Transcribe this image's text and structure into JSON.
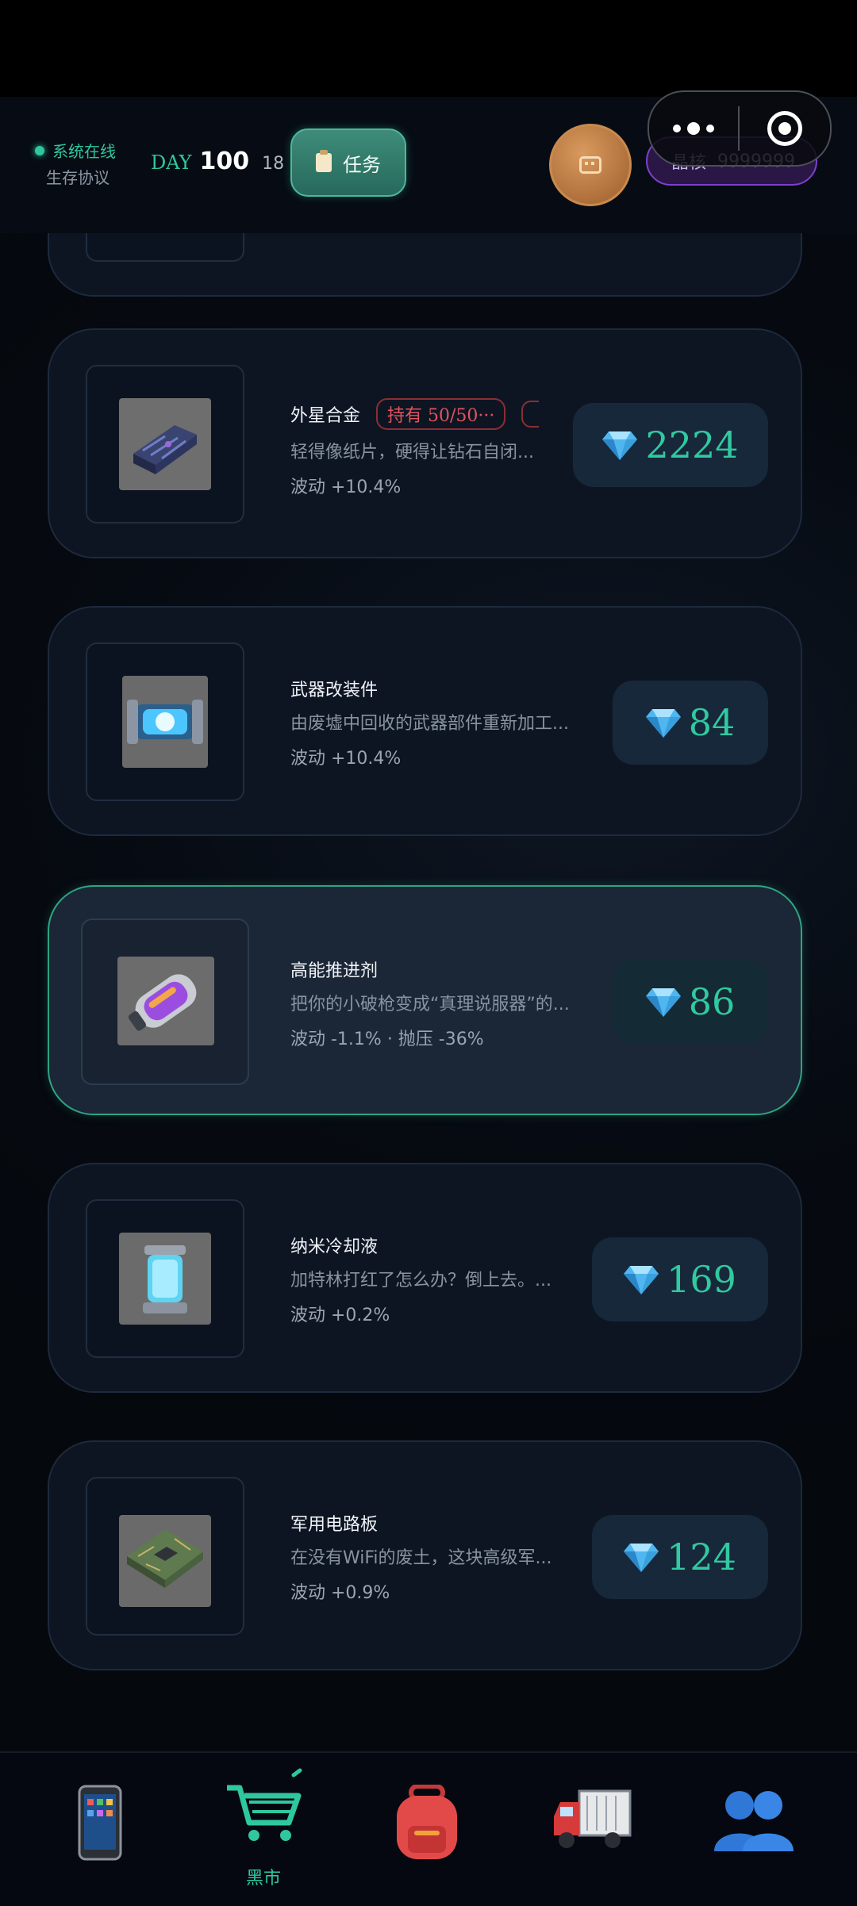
{
  "header": {
    "status_online": "系统在线",
    "status_protocol": "生存协议",
    "day_label": "DAY",
    "day_number": "100",
    "day_sub": "18",
    "task_button": "任务",
    "crystal_label": "晶核",
    "crystal_value": "9999999"
  },
  "items": [
    {
      "name": "外星合金",
      "tag": "持有 50/50···",
      "desc": "轻得像纸片，硬得让钻石自闭...",
      "fluct": "波动 +10.4%",
      "price": "2224"
    },
    {
      "name": "武器改装件",
      "desc": "由废墟中回收的武器部件重新加工...",
      "fluct": "波动 +10.4%",
      "price": "84"
    },
    {
      "name": "高能推进剂",
      "desc": "把你的小破枪变成“真理说服器”的...",
      "fluct": "波动 -1.1% · 抛压 -36%",
      "price": "86"
    },
    {
      "name": "纳米冷却液",
      "desc": "加特林打红了怎么办？倒上去。...",
      "fluct": "波动 +0.2%",
      "price": "169"
    },
    {
      "name": "军用电路板",
      "desc": "在没有WiFi的废土，这块高级军...",
      "fluct": "波动 +0.9%",
      "price": "124"
    }
  ],
  "nav": {
    "market_label": "黑市"
  },
  "colors": {
    "accent": "#2ec7a0",
    "danger": "#e0535e",
    "crystal": "#7e3fd0"
  }
}
